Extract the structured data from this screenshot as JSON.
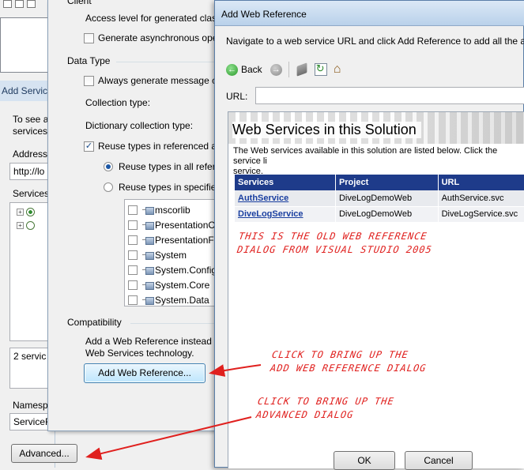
{
  "service_dialog": {
    "title": "Add Service",
    "intro": "To see a\nservices,",
    "address_label": "Address",
    "address_value": "http://lo",
    "services_label": "Services",
    "status_text": "2 servic",
    "namespace_label": "Namesp",
    "namespace_value": "ServiceR",
    "advanced_label": "Advanced..."
  },
  "settings_dialog": {
    "client_label": "Client",
    "access_level_label": "Access level for generated class",
    "generate_async_label": "Generate asynchronous ope",
    "generate_async_checked": false,
    "data_type_label": "Data Type",
    "always_generate_label": "Always generate message co",
    "always_generate_checked": false,
    "collection_type_label": "Collection type:",
    "dictionary_type_label": "Dictionary collection type:",
    "reuse_types_label": "Reuse types in referenced as",
    "reuse_types_checked": true,
    "reuse_all_label": "Reuse types in all refere",
    "reuse_all_selected": true,
    "reuse_specified_label": "Reuse types in specified",
    "reuse_specified_selected": false,
    "assemblies": [
      {
        "name": "mscorlib",
        "checked": false
      },
      {
        "name": "PresentationC",
        "checked": false
      },
      {
        "name": "PresentationFr",
        "checked": false
      },
      {
        "name": "System",
        "checked": false
      },
      {
        "name": "System.Config",
        "checked": false
      },
      {
        "name": "System.Core",
        "checked": false
      },
      {
        "name": "System.Data",
        "checked": false
      }
    ],
    "compatibility_label": "Compatibility",
    "compat_desc_line1": "Add a Web Reference instead o",
    "compat_desc_line2": "Web Services technology.",
    "add_web_ref_label": "Add Web Reference..."
  },
  "web_dialog": {
    "title": "Add Web Reference",
    "description": "Navigate to a web service URL and click Add Reference to add all the ava",
    "back_label": "Back",
    "url_label": "URL:",
    "url_value": "",
    "banner_title": "Web Services in this Solution",
    "banner_desc": "The Web services available in this solution are listed below. Click the service li\nservice.",
    "table": {
      "headers": [
        "Services",
        "Project",
        "URL"
      ],
      "rows": [
        {
          "service": "AuthService",
          "project": "DiveLogDemoWeb",
          "url": "AuthService.svc"
        },
        {
          "service": "DiveLogService",
          "project": "DiveLogDemoWeb",
          "url": "DiveLogService.svc"
        }
      ]
    },
    "ok_label": "OK",
    "cancel_label": "Cancel"
  },
  "annotations": {
    "old_dialog_line1": "THIS IS THE OLD WEB REFERENCE",
    "old_dialog_line2": "DIALOG FROM VISUAL STUDIO 2005",
    "add_web_line1": "CLICK TO BRING UP THE",
    "add_web_line2": "ADD WEB REFERENCE DIALOG",
    "advanced_line1": "CLICK TO BRING UP THE",
    "advanced_line2": "ADVANCED DIALOG",
    "ink_color": "#e0201e"
  }
}
